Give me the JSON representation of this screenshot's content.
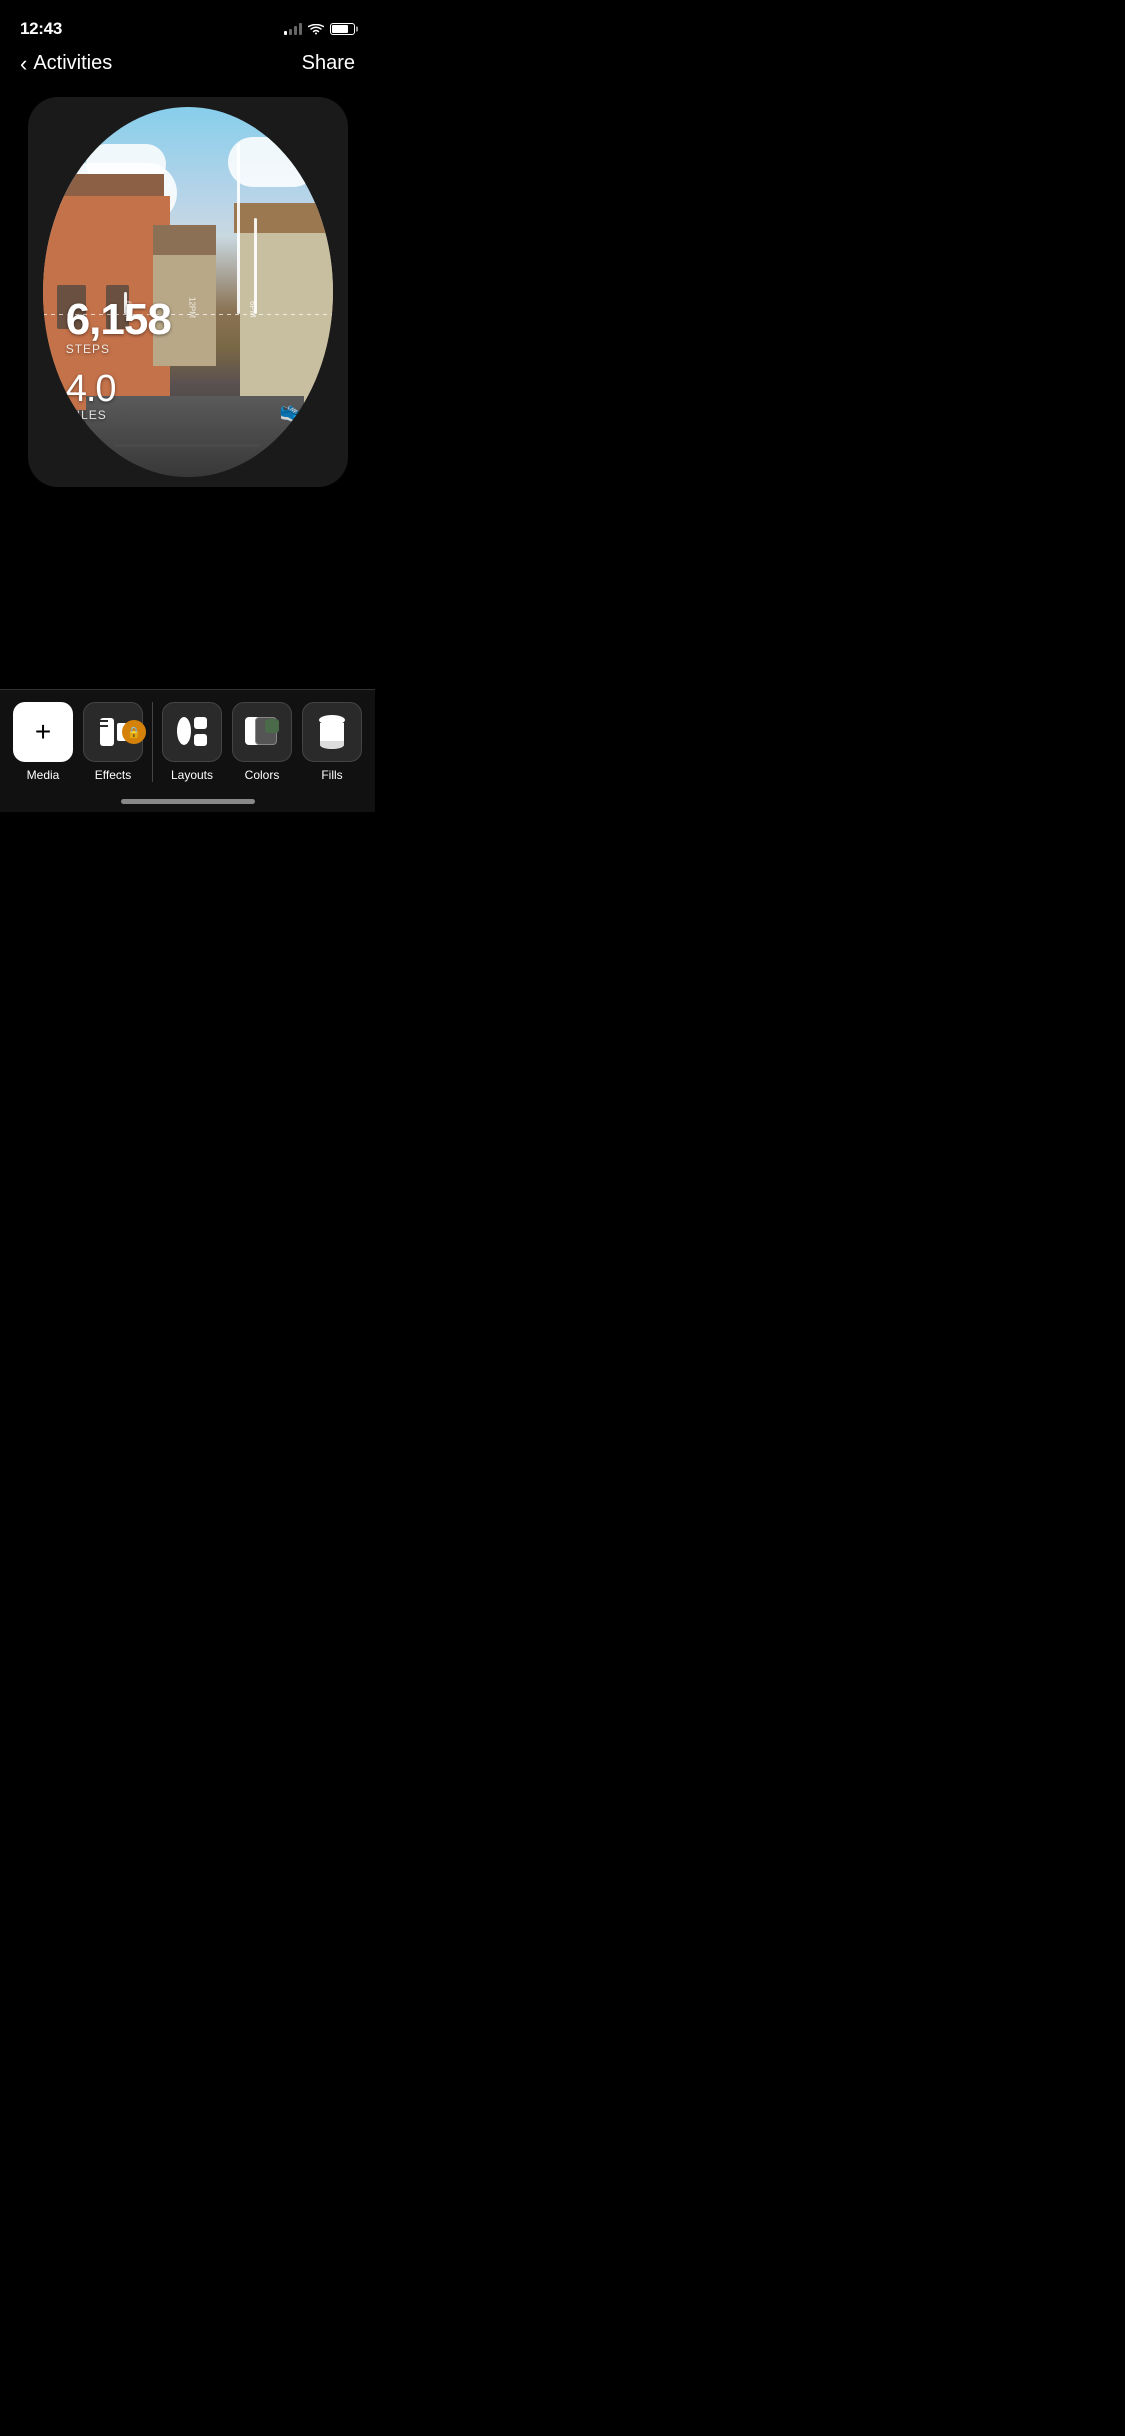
{
  "status_bar": {
    "time": "12:43",
    "signal_bars": [
      2,
      3,
      4,
      4
    ],
    "battery_level": 75
  },
  "nav": {
    "back_label": "Activities",
    "share_label": "Share"
  },
  "watch_face": {
    "steps": "6,158",
    "steps_label": "STEPS",
    "miles": "4.0",
    "miles_label": "MILES",
    "time_labels": {
      "t6am": "6AM",
      "t12pm": "12PM",
      "t6pm": "6PM"
    }
  },
  "toolbar": {
    "items": [
      {
        "id": "media",
        "label": "Media",
        "icon": "plus-icon"
      },
      {
        "id": "effects",
        "label": "Effects",
        "icon": "effects-icon",
        "has_lock": true
      },
      {
        "id": "layouts",
        "label": "Layouts",
        "icon": "layouts-icon"
      },
      {
        "id": "colors",
        "label": "Colors",
        "icon": "colors-icon"
      },
      {
        "id": "fills",
        "label": "Fills",
        "icon": "fills-icon"
      }
    ]
  }
}
